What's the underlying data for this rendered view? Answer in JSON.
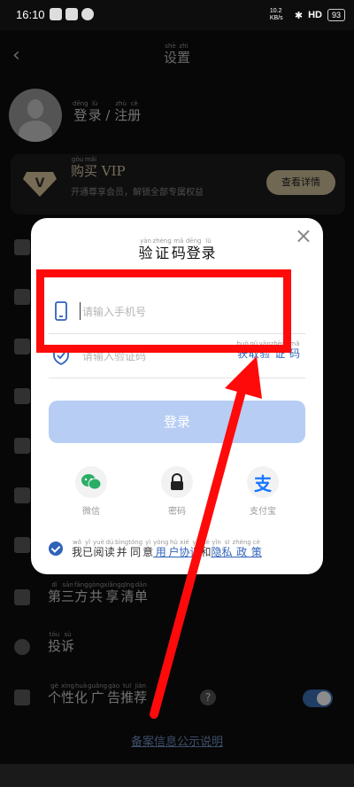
{
  "status_bar": {
    "time": "16:10",
    "net_speed": "10.2 KB/s",
    "network": "HD",
    "battery": "93"
  },
  "settings": {
    "title": {
      "chars": [
        "设",
        "置"
      ],
      "pinyin": [
        "shè",
        "zhì"
      ]
    },
    "login_link": {
      "chars": [
        "登",
        "录",
        " / ",
        "注",
        "册"
      ],
      "pinyin": [
        "dēng",
        "lù",
        "",
        "zhù",
        "cè"
      ]
    },
    "vip": {
      "title_chars": [
        "购",
        "买"
      ],
      "title_pinyin": [
        "gòu",
        "mǎi"
      ],
      "title_suffix": " VIP",
      "subtitle": "开通尊享会员，解锁全部专属权益",
      "button": "查看详情"
    },
    "rows": [
      {
        "chars": [
          "第",
          "三",
          "方",
          "共",
          "享",
          "清",
          "单"
        ],
        "pinyin": [
          "dì",
          "sān",
          "fāng",
          "gòng",
          "xiǎng",
          "qīng",
          "dān"
        ]
      },
      {
        "chars": [
          "投",
          "诉"
        ],
        "pinyin": [
          "tóu",
          "sù"
        ]
      },
      {
        "chars": [
          "个",
          "性",
          "化",
          "广",
          "告",
          "推",
          "荐"
        ],
        "pinyin": [
          "gè",
          "xìng",
          "huà",
          "guǎng",
          "gào",
          "tuī",
          "jiàn"
        ]
      }
    ],
    "help_icon": "?",
    "bottom_link": "备案信息公示说明"
  },
  "modal": {
    "close": "×",
    "title": {
      "chars": [
        "验",
        "证",
        "码",
        "登",
        "录"
      ],
      "pinyin": [
        "yàn",
        "zhèng",
        "mǎ",
        "dēng",
        "lù"
      ]
    },
    "phone_placeholder": "请输入手机号",
    "code_placeholder": "请输入验证码",
    "get_code": {
      "chars": [
        "获",
        "取",
        "验",
        "证",
        "码"
      ],
      "pinyin": [
        "huò",
        "qǔ",
        "yàn",
        "zhèng",
        "mǎ"
      ]
    },
    "login_button": "登录",
    "alt_logins": [
      {
        "label": "微信",
        "icon": "wechat-icon"
      },
      {
        "label": "密码",
        "icon": "lock-icon"
      },
      {
        "label": "支付宝",
        "icon": "alipay-icon"
      }
    ],
    "agreement": {
      "chars": [
        "我",
        "已",
        "阅",
        "读",
        "并",
        "同",
        "意"
      ],
      "pinyin": [
        "wǒ",
        "yǐ",
        "yuè",
        "dú",
        "bìng",
        "tóng",
        "yì"
      ],
      "user_agreement_chars": [
        "用",
        "户",
        "协",
        "议"
      ],
      "user_agreement_pinyin": [
        "yòng",
        "hù",
        "xié",
        "yì"
      ],
      "conj_char": "和",
      "conj_pinyin": "hé",
      "privacy_chars": [
        "隐",
        "私",
        "政",
        "策"
      ],
      "privacy_pinyin": [
        "yǐn",
        "sī",
        "zhèng",
        "cè"
      ]
    }
  },
  "colors": {
    "accent": "#2f63b8",
    "highlight": "#ff0a0a",
    "login_button_disabled": "#b7cdf4"
  }
}
